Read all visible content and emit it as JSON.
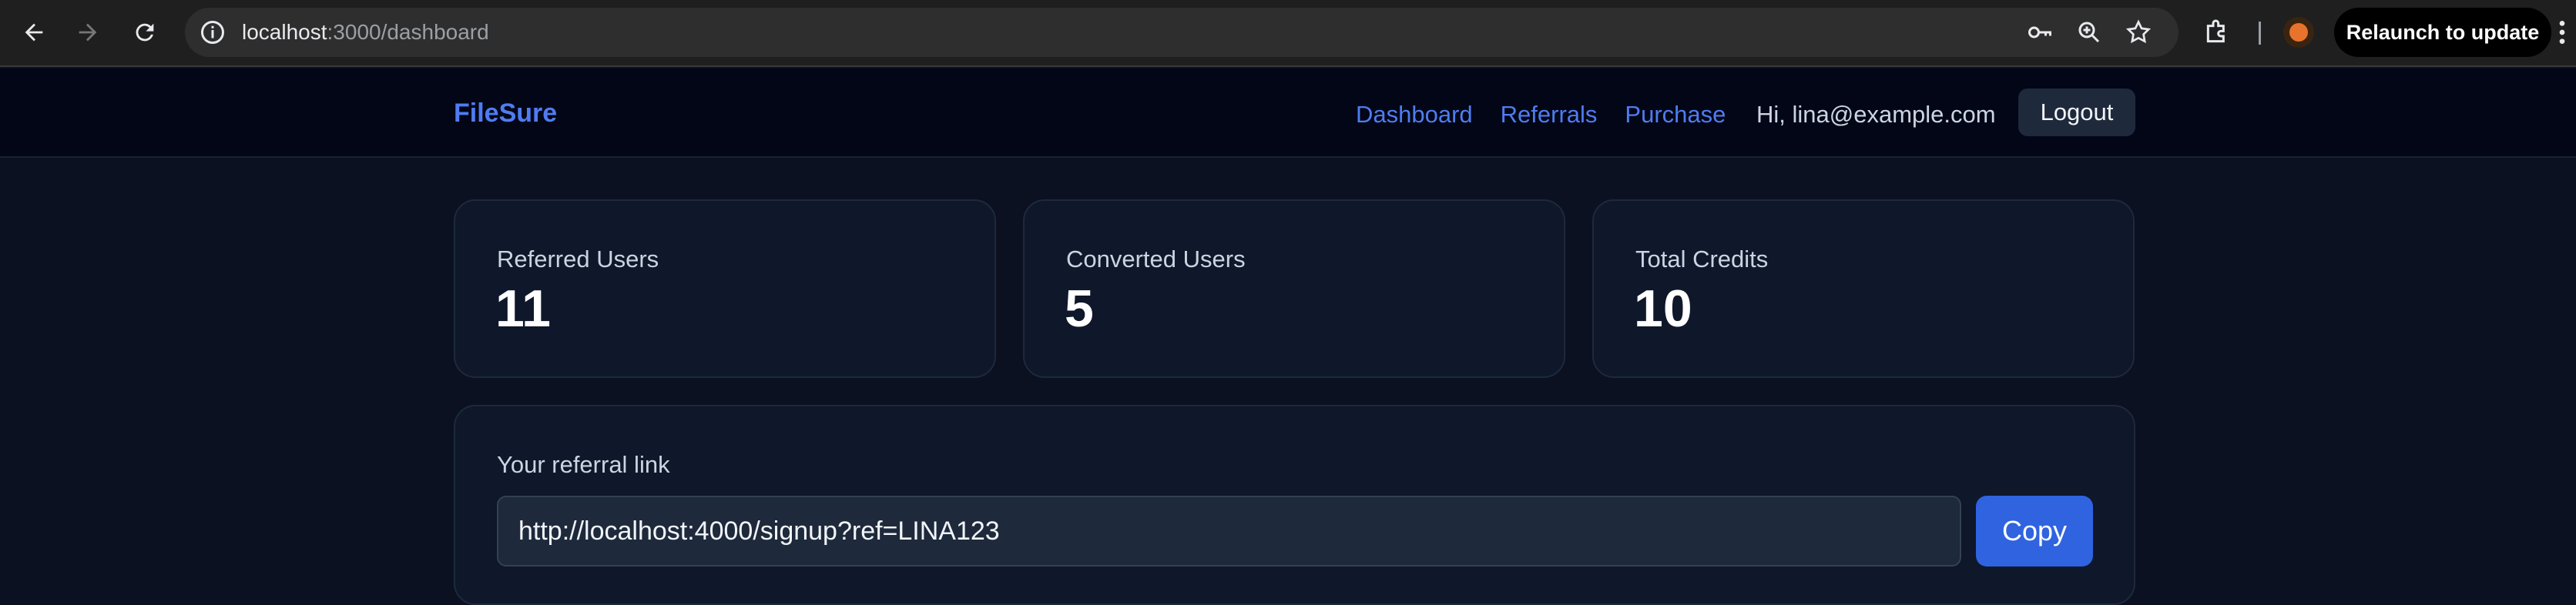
{
  "browser": {
    "url_host": "localhost",
    "url_path": ":3000/dashboard",
    "relaunch_label": "Relaunch to update"
  },
  "header": {
    "brand": "FileSure",
    "nav": [
      "Dashboard",
      "Referrals",
      "Purchase"
    ],
    "greeting": "Hi, lina@example.com",
    "logout_label": "Logout"
  },
  "stats": [
    {
      "label": "Referred Users",
      "value": "11"
    },
    {
      "label": "Converted Users",
      "value": "5"
    },
    {
      "label": "Total Credits",
      "value": "10"
    }
  ],
  "referral": {
    "label": "Your referral link",
    "link": "http://localhost:4000/signup?ref=LINA123",
    "copy_label": "Copy"
  },
  "colors": {
    "page_bg": "#0b1120",
    "header_bg": "#020617",
    "card_bg": "#0f172a",
    "accent": "#4f7cf0",
    "button_primary": "#2f63e0"
  }
}
